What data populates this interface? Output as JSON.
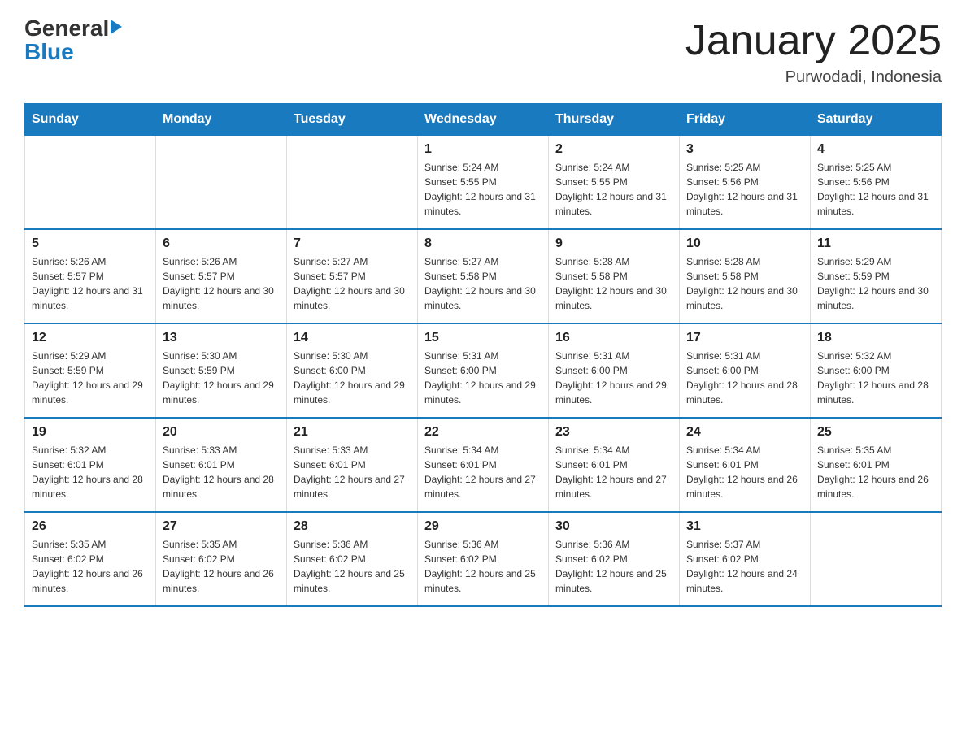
{
  "header": {
    "logo_text_main": "General",
    "logo_text_accent": "Blue",
    "title": "January 2025",
    "subtitle": "Purwodadi, Indonesia"
  },
  "days_of_week": [
    "Sunday",
    "Monday",
    "Tuesday",
    "Wednesday",
    "Thursday",
    "Friday",
    "Saturday"
  ],
  "weeks": [
    [
      {
        "day": "",
        "info": ""
      },
      {
        "day": "",
        "info": ""
      },
      {
        "day": "",
        "info": ""
      },
      {
        "day": "1",
        "info": "Sunrise: 5:24 AM\nSunset: 5:55 PM\nDaylight: 12 hours and 31 minutes."
      },
      {
        "day": "2",
        "info": "Sunrise: 5:24 AM\nSunset: 5:55 PM\nDaylight: 12 hours and 31 minutes."
      },
      {
        "day": "3",
        "info": "Sunrise: 5:25 AM\nSunset: 5:56 PM\nDaylight: 12 hours and 31 minutes."
      },
      {
        "day": "4",
        "info": "Sunrise: 5:25 AM\nSunset: 5:56 PM\nDaylight: 12 hours and 31 minutes."
      }
    ],
    [
      {
        "day": "5",
        "info": "Sunrise: 5:26 AM\nSunset: 5:57 PM\nDaylight: 12 hours and 31 minutes."
      },
      {
        "day": "6",
        "info": "Sunrise: 5:26 AM\nSunset: 5:57 PM\nDaylight: 12 hours and 30 minutes."
      },
      {
        "day": "7",
        "info": "Sunrise: 5:27 AM\nSunset: 5:57 PM\nDaylight: 12 hours and 30 minutes."
      },
      {
        "day": "8",
        "info": "Sunrise: 5:27 AM\nSunset: 5:58 PM\nDaylight: 12 hours and 30 minutes."
      },
      {
        "day": "9",
        "info": "Sunrise: 5:28 AM\nSunset: 5:58 PM\nDaylight: 12 hours and 30 minutes."
      },
      {
        "day": "10",
        "info": "Sunrise: 5:28 AM\nSunset: 5:58 PM\nDaylight: 12 hours and 30 minutes."
      },
      {
        "day": "11",
        "info": "Sunrise: 5:29 AM\nSunset: 5:59 PM\nDaylight: 12 hours and 30 minutes."
      }
    ],
    [
      {
        "day": "12",
        "info": "Sunrise: 5:29 AM\nSunset: 5:59 PM\nDaylight: 12 hours and 29 minutes."
      },
      {
        "day": "13",
        "info": "Sunrise: 5:30 AM\nSunset: 5:59 PM\nDaylight: 12 hours and 29 minutes."
      },
      {
        "day": "14",
        "info": "Sunrise: 5:30 AM\nSunset: 6:00 PM\nDaylight: 12 hours and 29 minutes."
      },
      {
        "day": "15",
        "info": "Sunrise: 5:31 AM\nSunset: 6:00 PM\nDaylight: 12 hours and 29 minutes."
      },
      {
        "day": "16",
        "info": "Sunrise: 5:31 AM\nSunset: 6:00 PM\nDaylight: 12 hours and 29 minutes."
      },
      {
        "day": "17",
        "info": "Sunrise: 5:31 AM\nSunset: 6:00 PM\nDaylight: 12 hours and 28 minutes."
      },
      {
        "day": "18",
        "info": "Sunrise: 5:32 AM\nSunset: 6:00 PM\nDaylight: 12 hours and 28 minutes."
      }
    ],
    [
      {
        "day": "19",
        "info": "Sunrise: 5:32 AM\nSunset: 6:01 PM\nDaylight: 12 hours and 28 minutes."
      },
      {
        "day": "20",
        "info": "Sunrise: 5:33 AM\nSunset: 6:01 PM\nDaylight: 12 hours and 28 minutes."
      },
      {
        "day": "21",
        "info": "Sunrise: 5:33 AM\nSunset: 6:01 PM\nDaylight: 12 hours and 27 minutes."
      },
      {
        "day": "22",
        "info": "Sunrise: 5:34 AM\nSunset: 6:01 PM\nDaylight: 12 hours and 27 minutes."
      },
      {
        "day": "23",
        "info": "Sunrise: 5:34 AM\nSunset: 6:01 PM\nDaylight: 12 hours and 27 minutes."
      },
      {
        "day": "24",
        "info": "Sunrise: 5:34 AM\nSunset: 6:01 PM\nDaylight: 12 hours and 26 minutes."
      },
      {
        "day": "25",
        "info": "Sunrise: 5:35 AM\nSunset: 6:01 PM\nDaylight: 12 hours and 26 minutes."
      }
    ],
    [
      {
        "day": "26",
        "info": "Sunrise: 5:35 AM\nSunset: 6:02 PM\nDaylight: 12 hours and 26 minutes."
      },
      {
        "day": "27",
        "info": "Sunrise: 5:35 AM\nSunset: 6:02 PM\nDaylight: 12 hours and 26 minutes."
      },
      {
        "day": "28",
        "info": "Sunrise: 5:36 AM\nSunset: 6:02 PM\nDaylight: 12 hours and 25 minutes."
      },
      {
        "day": "29",
        "info": "Sunrise: 5:36 AM\nSunset: 6:02 PM\nDaylight: 12 hours and 25 minutes."
      },
      {
        "day": "30",
        "info": "Sunrise: 5:36 AM\nSunset: 6:02 PM\nDaylight: 12 hours and 25 minutes."
      },
      {
        "day": "31",
        "info": "Sunrise: 5:37 AM\nSunset: 6:02 PM\nDaylight: 12 hours and 24 minutes."
      },
      {
        "day": "",
        "info": ""
      }
    ]
  ]
}
